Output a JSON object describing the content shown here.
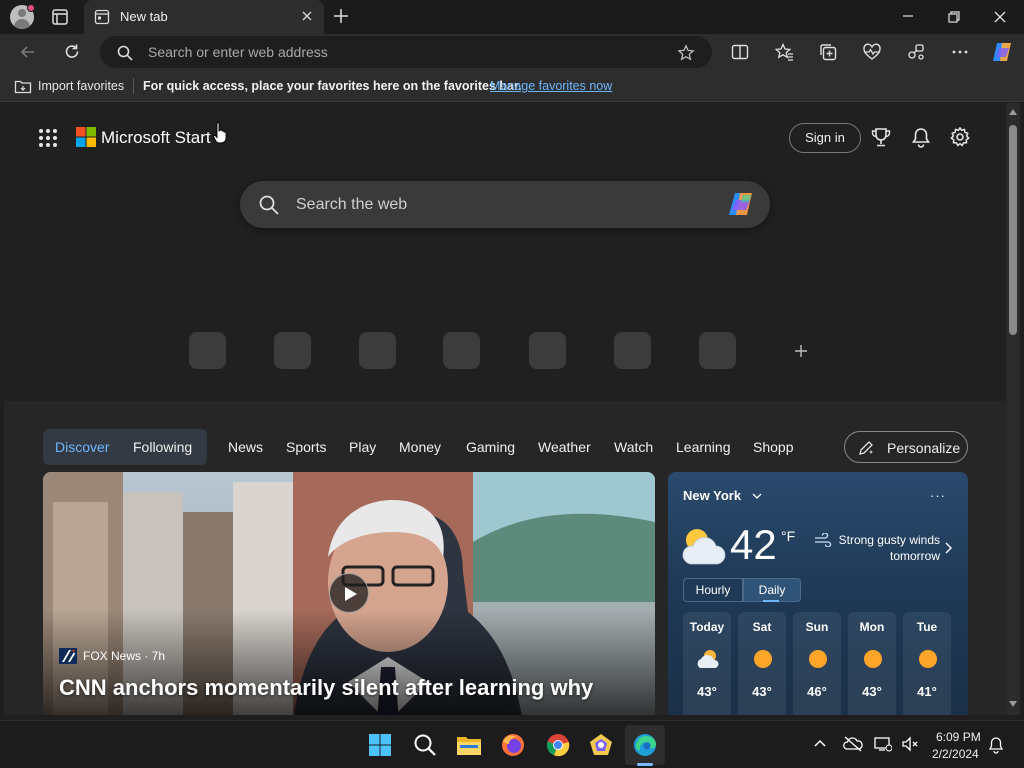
{
  "browser": {
    "tab_title": "New tab",
    "address_placeholder": "Search or enter web address",
    "favorites_bar": {
      "import_label": "Import favorites",
      "hint": "For quick access, place your favorites here on the favorites bar.",
      "link": "Manage favorites now"
    }
  },
  "header": {
    "brand": "Microsoft Start",
    "sign_in": "Sign in"
  },
  "search": {
    "placeholder": "Search the web"
  },
  "feed": {
    "toggle": {
      "discover": "Discover",
      "following": "Following"
    },
    "nav": [
      "News",
      "Sports",
      "Play",
      "Money",
      "Gaming",
      "Weather",
      "Watch",
      "Learning",
      "Shopp"
    ],
    "personalize": "Personalize"
  },
  "hero": {
    "source": "FOX News · 7h",
    "title": "CNN anchors momentarily silent after learning why",
    "title_line2": "...                                                                        "
  },
  "weather": {
    "location": "New York",
    "more": "···",
    "temperature": "42",
    "unit": "°F",
    "alert": "Strong gusty winds tomorrow",
    "tabs": {
      "hourly": "Hourly",
      "daily": "Daily"
    },
    "forecast": [
      {
        "day": "Today",
        "temp": "43°",
        "icon": "partly-cloudy-icon"
      },
      {
        "day": "Sat",
        "temp": "43°",
        "icon": "sun-icon"
      },
      {
        "day": "Sun",
        "temp": "46°",
        "icon": "sun-icon"
      },
      {
        "day": "Mon",
        "temp": "43°",
        "icon": "sun-icon"
      },
      {
        "day": "Tue",
        "temp": "41°",
        "icon": "sun-icon"
      }
    ]
  },
  "taskbar": {
    "time": "6:09 PM",
    "date": "2/2/2024"
  },
  "colors": {
    "accent": "#6cb6ff",
    "page_bg": "#202020",
    "weather_bg": "#2a4a6e"
  }
}
